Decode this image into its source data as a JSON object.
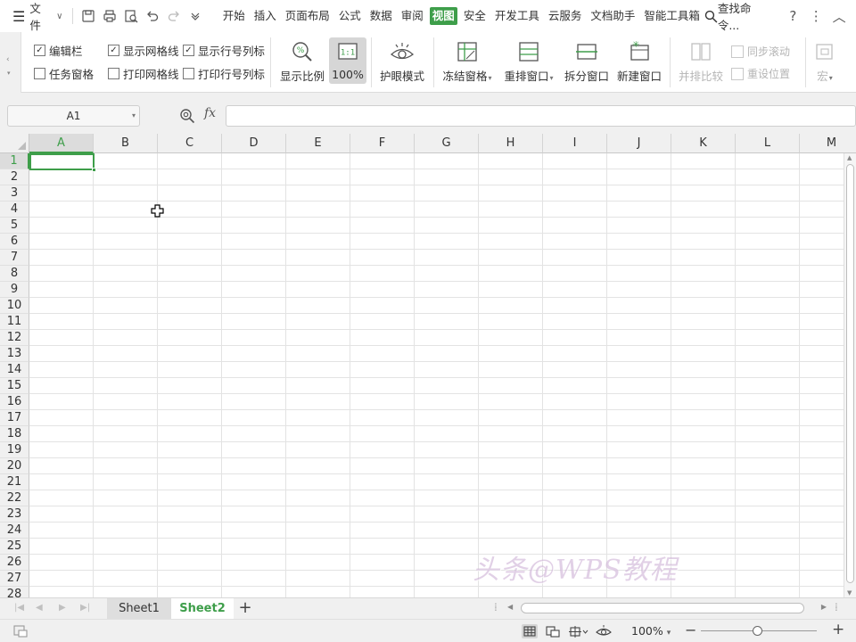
{
  "menubar": {
    "file_label": "文件",
    "tabs": [
      {
        "label": "开始",
        "active": false
      },
      {
        "label": "插入",
        "active": false
      },
      {
        "label": "页面布局",
        "active": false
      },
      {
        "label": "公式",
        "active": false
      },
      {
        "label": "数据",
        "active": false
      },
      {
        "label": "审阅",
        "active": false
      },
      {
        "label": "视图",
        "active": true
      },
      {
        "label": "安全",
        "active": false
      },
      {
        "label": "开发工具",
        "active": false
      },
      {
        "label": "云服务",
        "active": false
      },
      {
        "label": "文档助手",
        "active": false
      },
      {
        "label": "智能工具箱",
        "active": false
      }
    ],
    "search_label": "查找命令...",
    "help_label": "?",
    "more_label": "⋮",
    "collapse_label": "︿"
  },
  "ribbon": {
    "checkboxes": {
      "edit_bar": {
        "label": "编辑栏",
        "checked": true
      },
      "task_pane": {
        "label": "任务窗格",
        "checked": false
      },
      "show_gridlines": {
        "label": "显示网格线",
        "checked": true
      },
      "print_gridlines": {
        "label": "打印网格线",
        "checked": false
      },
      "show_headings": {
        "label": "显示行号列标",
        "checked": true
      },
      "print_headings": {
        "label": "打印行号列标",
        "checked": false
      }
    },
    "buttons": {
      "zoom_ratio": "显示比例",
      "zoom_100": "100%",
      "eye_mode": "护眼模式",
      "freeze": "冻结窗格",
      "rearrange": "重排窗口",
      "split": "拆分窗口",
      "new_window": "新建窗口",
      "side_by_side": "并排比较",
      "sync_scroll": "同步滚动",
      "reset_position": "重设位置",
      "macro": "宏"
    }
  },
  "formulabar": {
    "namebox_value": "A1",
    "fx_label": "fx",
    "formula_value": ""
  },
  "grid": {
    "columns": [
      "A",
      "B",
      "C",
      "D",
      "E",
      "F",
      "G",
      "H",
      "I",
      "J",
      "K",
      "L",
      "M"
    ],
    "rows": [
      "1",
      "2",
      "3",
      "4",
      "5",
      "6",
      "7",
      "8",
      "9",
      "10",
      "11",
      "12",
      "13",
      "14",
      "15",
      "16",
      "17",
      "18",
      "19",
      "20",
      "21",
      "22",
      "23",
      "24",
      "25",
      "26",
      "27",
      "28"
    ],
    "selected_cell": "A1"
  },
  "watermark": "头条@WPS教程",
  "sheets": {
    "tabs": [
      {
        "label": "Sheet1",
        "active": false
      },
      {
        "label": "Sheet2",
        "active": true
      }
    ],
    "add_label": "+"
  },
  "statusbar": {
    "zoom": "100%",
    "zoom_dropdown": "▾",
    "zoom_level_fraction": 0.5
  },
  "colors": {
    "accent": "#3e9e4a",
    "gridline": "#e3e3e3",
    "header_bg": "#f0f0f0"
  }
}
